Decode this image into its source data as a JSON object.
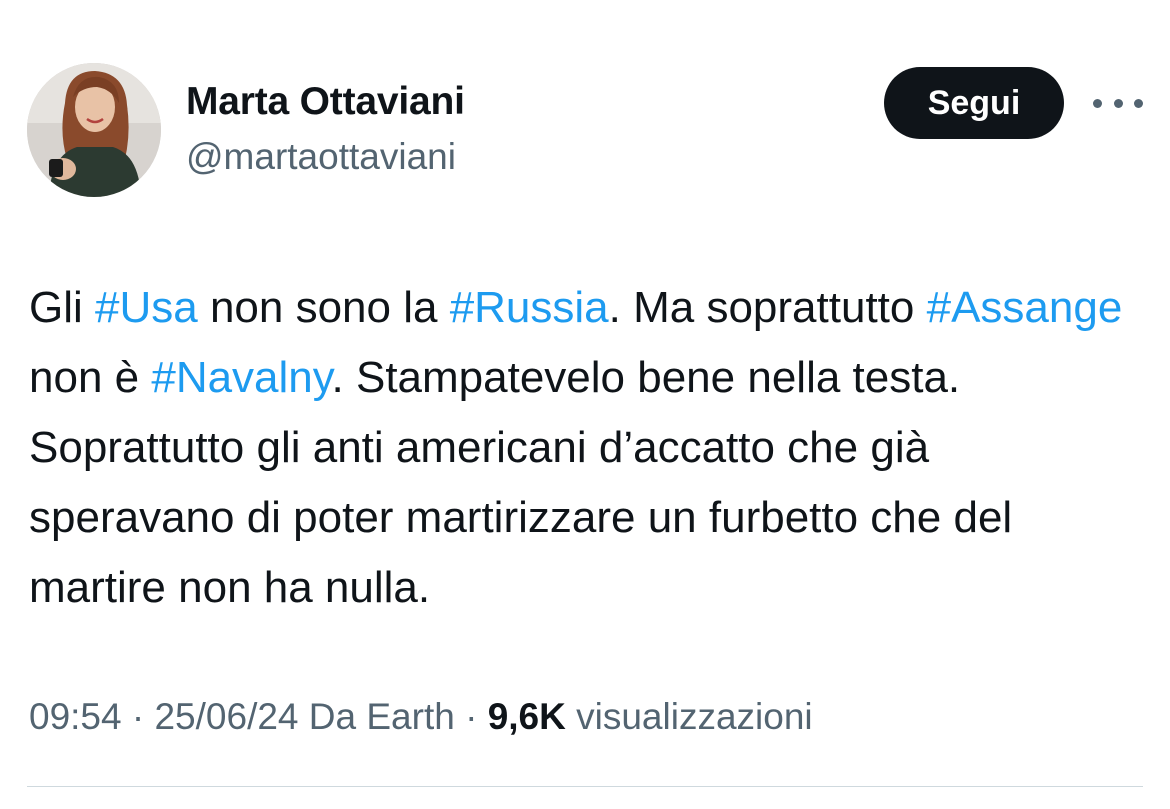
{
  "author": {
    "display_name": "Marta Ottaviani",
    "handle": "@martaottaviani"
  },
  "follow_button_label": "Segui",
  "more_icon": "more-horizontal-icon",
  "tweet": {
    "segments": [
      {
        "text": "Gli ",
        "type": "text"
      },
      {
        "text": "#Usa",
        "type": "hashtag"
      },
      {
        "text": " non sono la ",
        "type": "text"
      },
      {
        "text": "#Russia",
        "type": "hashtag"
      },
      {
        "text": ". Ma soprattutto ",
        "type": "text"
      },
      {
        "text": "#Assange",
        "type": "hashtag"
      },
      {
        "text": " non è ",
        "type": "text"
      },
      {
        "text": "#Navalny",
        "type": "hashtag"
      },
      {
        "text": ". Stampatevelo bene nella testa. Soprattutto gli anti americani d’accatto che già speravano di poter martirizzare un furbetto che del martire non ha nulla.",
        "type": "text"
      }
    ]
  },
  "meta": {
    "time": "09:54",
    "separator_1": " · ",
    "date": "25/06/24",
    "source": " Da Earth",
    "separator_2": " · ",
    "views_count": "9,6K",
    "views_label": " visualizzazioni"
  },
  "colors": {
    "hashtag": "#1d9bf0",
    "primary_text": "#0f1419",
    "secondary_text": "#536471",
    "follow_button_bg": "#0f1419"
  }
}
